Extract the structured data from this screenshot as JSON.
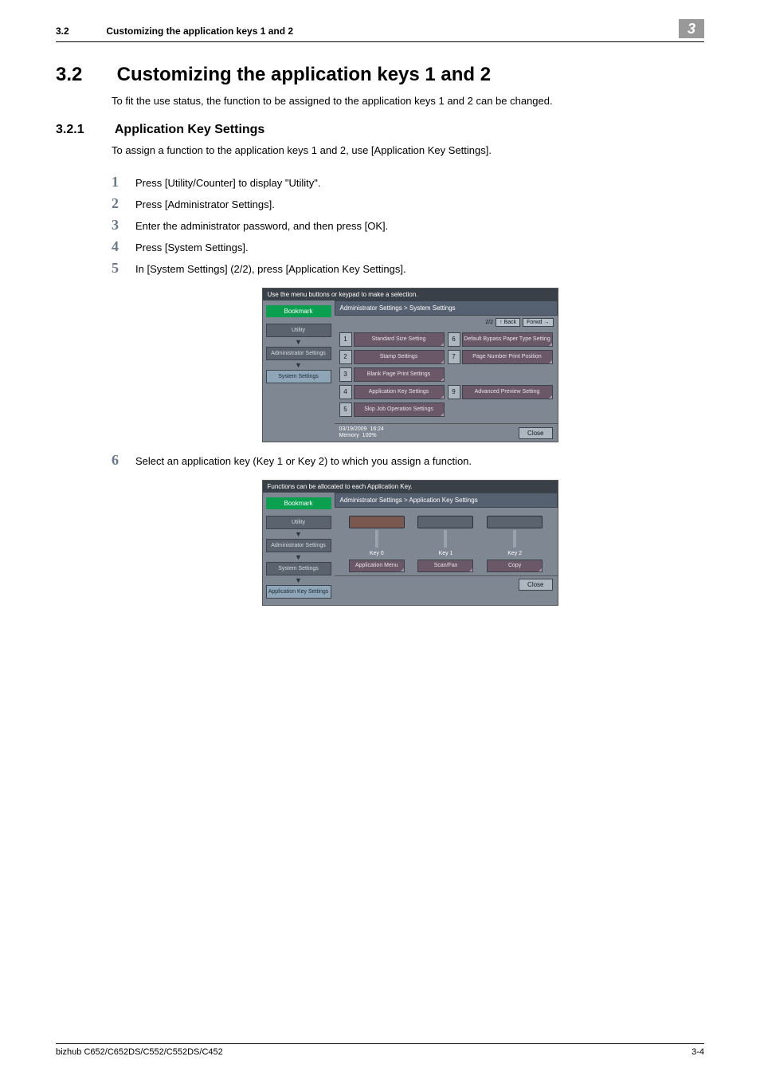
{
  "header": {
    "section_num": "3.2",
    "section_title": "Customizing the application keys 1 and 2",
    "chapter_badge": "3"
  },
  "h1": {
    "num": "3.2",
    "title": "Customizing the application keys 1 and 2"
  },
  "intro": "To fit the use status, the function to be assigned to the application keys 1 and 2 can be changed.",
  "h2": {
    "num": "3.2.1",
    "title": "Application Key Settings"
  },
  "sub_intro": "To assign a function to the application keys 1 and 2, use [Application Key Settings].",
  "steps": [
    "Press [Utility/Counter] to display \"Utility\".",
    "Press [Administrator Settings].",
    "Enter the administrator password, and then press [OK].",
    "Press [System Settings].",
    "In [System Settings] (2/2), press [Application Key Settings].",
    "Select an application key (Key 1 or Key 2) to which you assign a function."
  ],
  "shot1": {
    "top": "Use the menu buttons or keypad to make a selection.",
    "breadcrumb": "Administrator Settings > System Settings",
    "bookmark": "Bookmark",
    "side": [
      "Utility",
      "Administrator Settings",
      "System Settings"
    ],
    "pager": {
      "page": "2/2",
      "back": "Back",
      "fwd": "Forwd"
    },
    "options": [
      {
        "n": "1",
        "label": "Standard Size Setting"
      },
      {
        "n": "6",
        "label": "Default Bypass Paper Type Setting"
      },
      {
        "n": "2",
        "label": "Stamp Settings"
      },
      {
        "n": "7",
        "label": "Page Number Print Position"
      },
      {
        "n": "3",
        "label": "Blank Page Print Settings"
      },
      {
        "n": "",
        "label": ""
      },
      {
        "n": "4",
        "label": "Application Key Settings"
      },
      {
        "n": "9",
        "label": "Advanced Preview Setting"
      },
      {
        "n": "5",
        "label": "Skip Job Operation Settings"
      },
      {
        "n": "",
        "label": ""
      }
    ],
    "date": "03/19/2009",
    "time": "16:24",
    "mem_label": "Memory",
    "mem_val": "100%",
    "close": "Close"
  },
  "shot2": {
    "top": "Functions can be allocated to each Application Key.",
    "breadcrumb": "Administrator Settings > Application Key Settings",
    "bookmark": "Bookmark",
    "side": [
      "Utility",
      "Administrator Settings",
      "System Settings",
      "Application Key Settings"
    ],
    "keys": [
      {
        "name": "Key 0",
        "func": "Application Menu"
      },
      {
        "name": "Key 1",
        "func": "Scan/Fax"
      },
      {
        "name": "Key 2",
        "func": "Copy"
      }
    ],
    "close": "Close"
  },
  "footer": {
    "left": "bizhub C652/C652DS/C552/C552DS/C452",
    "right": "3-4"
  }
}
